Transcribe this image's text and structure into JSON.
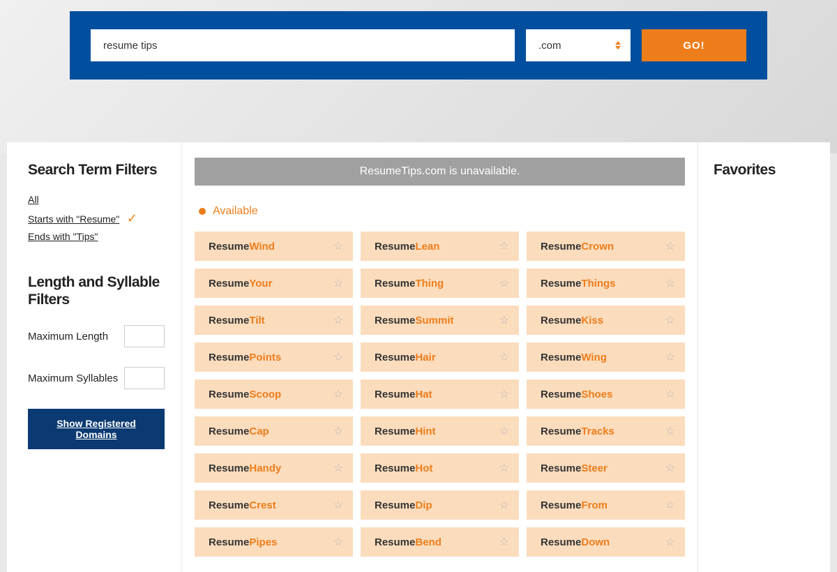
{
  "search": {
    "value": "resume tips",
    "tld": ".com",
    "go_label": "GO!"
  },
  "sidebar": {
    "filters_heading": "Search Term Filters",
    "filter_all": "All",
    "filter_starts": "Starts with \"Resume\"",
    "filter_ends": "Ends with \"Tips\"",
    "length_heading": "Length and Syllable Filters",
    "max_length_label": "Maximum Length",
    "max_syllables_label": "Maximum Syllables",
    "show_registered": "Show Registered Domains"
  },
  "main": {
    "status": "ResumeTips.com is unavailable.",
    "available_label": "Available",
    "domain_base": "Resume",
    "suffixes": [
      [
        "Wind",
        "Lean",
        "Crown"
      ],
      [
        "Your",
        "Thing",
        "Things"
      ],
      [
        "Tilt",
        "Summit",
        "Kiss"
      ],
      [
        "Points",
        "Hair",
        "Wing"
      ],
      [
        "Scoop",
        "Hat",
        "Shoes"
      ],
      [
        "Cap",
        "Hint",
        "Tracks"
      ],
      [
        "Handy",
        "Hot",
        "Steer"
      ],
      [
        "Crest",
        "Dip",
        "From"
      ],
      [
        "Pipes",
        "Bend",
        "Down"
      ]
    ]
  },
  "favorites": {
    "heading": "Favorites"
  },
  "colors": {
    "brand_blue": "#004f9e",
    "brand_orange": "#ed7d1a",
    "card_bg": "#fbdcbd"
  }
}
